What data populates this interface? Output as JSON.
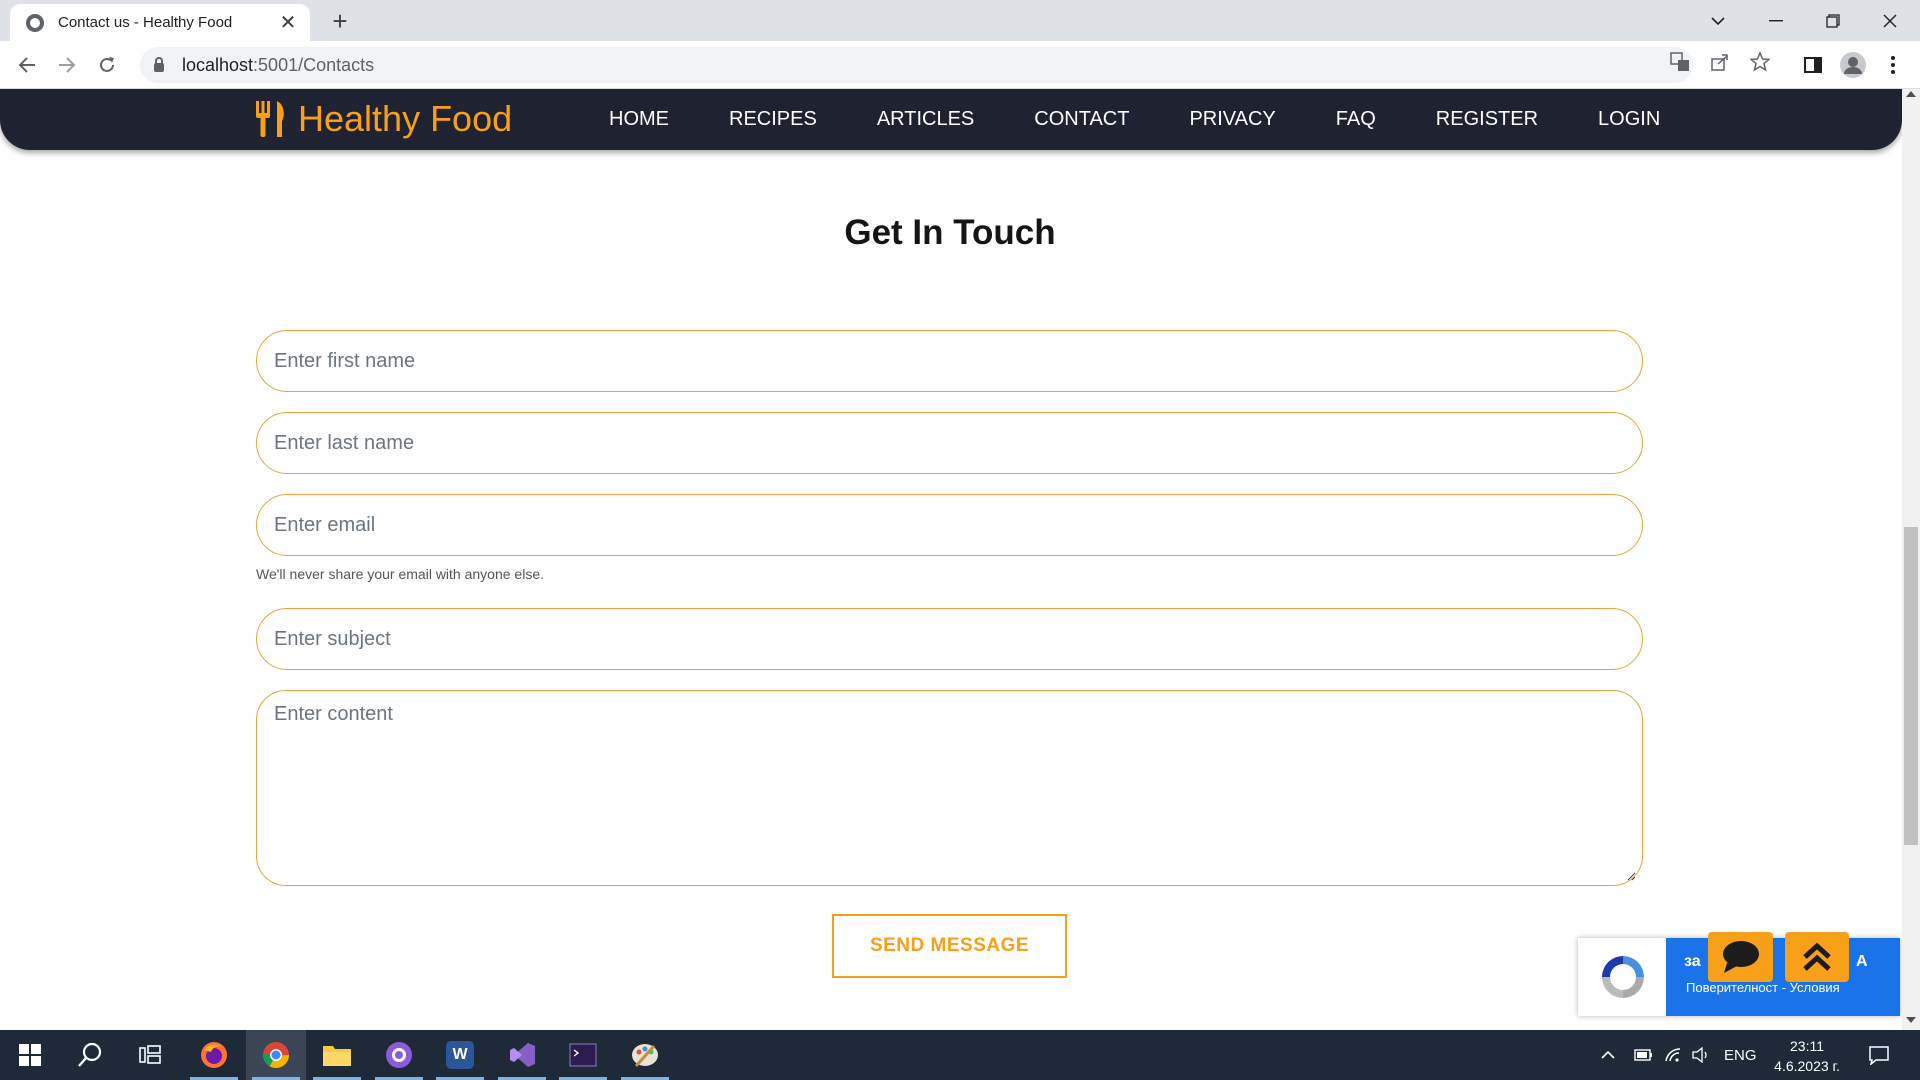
{
  "browser": {
    "tab_title": "Contact us - Healthy Food",
    "tab_close": "✕",
    "new_tab": "+",
    "url_host": "localhost",
    "url_path": ":5001/Contacts"
  },
  "site": {
    "brand": "Healthy Food",
    "nav": [
      "HOME",
      "RECIPES",
      "ARTICLES",
      "CONTACT",
      "PRIVACY",
      "FAQ",
      "REGISTER",
      "LOGIN"
    ],
    "accent_color": "#f8a019",
    "navbar_color": "#1f2230"
  },
  "form": {
    "title": "Get In Touch",
    "first_name_placeholder": "Enter first name",
    "last_name_placeholder": "Enter last name",
    "email_placeholder": "Enter email",
    "email_hint": "We'll never share your email with anyone else.",
    "subject_placeholder": "Enter subject",
    "content_placeholder": "Enter content",
    "submit_label": "SEND MESSAGE"
  },
  "recaptcha": {
    "line1_start": "за",
    "line1_end": "A",
    "line2": "Поверителност - Условия"
  },
  "taskbar": {
    "language": "ENG",
    "time": "23:11",
    "date": "4.6.2023 г."
  }
}
